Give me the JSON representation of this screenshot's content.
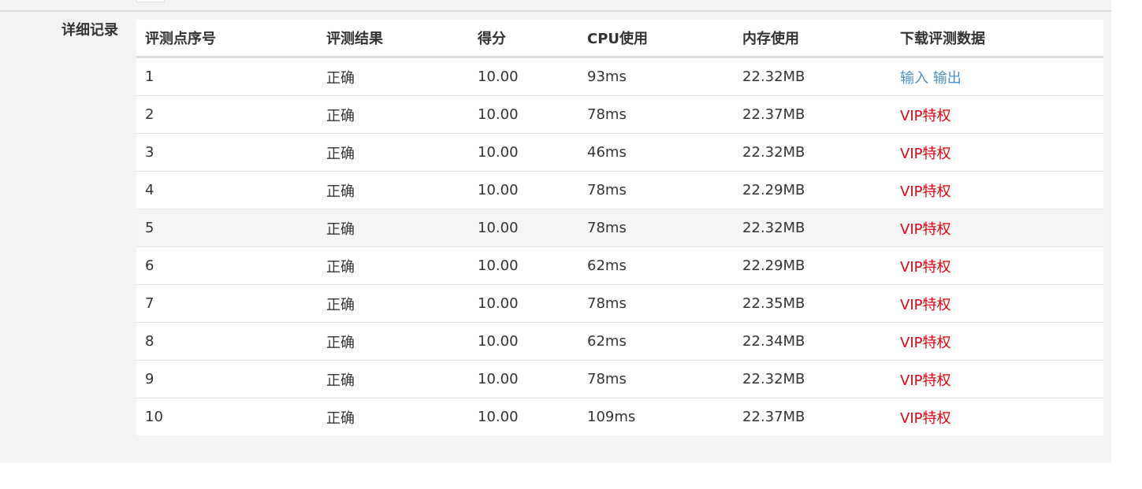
{
  "section": {
    "label": "详细记录"
  },
  "table": {
    "headers": [
      "评测点序号",
      "评测结果",
      "得分",
      "CPU使用",
      "内存使用",
      "下载评测数据"
    ],
    "rows": [
      {
        "index": "1",
        "result": "正确",
        "score": "10.00",
        "cpu": "93ms",
        "memory": "22.32MB",
        "download": {
          "input": "输入",
          "output": "输出"
        }
      },
      {
        "index": "2",
        "result": "正确",
        "score": "10.00",
        "cpu": "78ms",
        "memory": "22.37MB",
        "download": {
          "vip": "VIP特权"
        }
      },
      {
        "index": "3",
        "result": "正确",
        "score": "10.00",
        "cpu": "46ms",
        "memory": "22.32MB",
        "download": {
          "vip": "VIP特权"
        }
      },
      {
        "index": "4",
        "result": "正确",
        "score": "10.00",
        "cpu": "78ms",
        "memory": "22.29MB",
        "download": {
          "vip": "VIP特权"
        }
      },
      {
        "index": "5",
        "result": "正确",
        "score": "10.00",
        "cpu": "78ms",
        "memory": "22.32MB",
        "download": {
          "vip": "VIP特权"
        }
      },
      {
        "index": "6",
        "result": "正确",
        "score": "10.00",
        "cpu": "62ms",
        "memory": "22.29MB",
        "download": {
          "vip": "VIP特权"
        }
      },
      {
        "index": "7",
        "result": "正确",
        "score": "10.00",
        "cpu": "78ms",
        "memory": "22.35MB",
        "download": {
          "vip": "VIP特权"
        }
      },
      {
        "index": "8",
        "result": "正确",
        "score": "10.00",
        "cpu": "62ms",
        "memory": "22.34MB",
        "download": {
          "vip": "VIP特权"
        }
      },
      {
        "index": "9",
        "result": "正确",
        "score": "10.00",
        "cpu": "78ms",
        "memory": "22.32MB",
        "download": {
          "vip": "VIP特权"
        }
      },
      {
        "index": "10",
        "result": "正确",
        "score": "10.00",
        "cpu": "109ms",
        "memory": "22.37MB",
        "download": {
          "vip": "VIP特权"
        }
      }
    ]
  },
  "colors": {
    "link": "#4a90c8",
    "vip": "#e60012",
    "panel_bg": "#f4f4f5",
    "row_hover": "#f5f5f5"
  }
}
